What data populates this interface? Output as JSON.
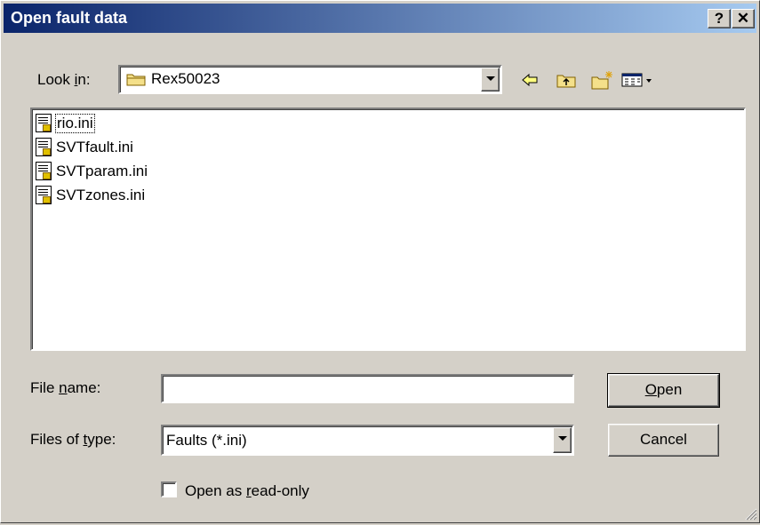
{
  "window": {
    "title": "Open fault data",
    "help_label": "?",
    "close_label": "✕"
  },
  "lookin": {
    "label_prefix": "Look ",
    "label_accel": "i",
    "label_suffix": "n:",
    "folder": "Rex50023"
  },
  "toolbar": {
    "back_icon": "back-arrow-icon",
    "up_icon": "up-folder-icon",
    "newfolder_icon": "new-folder-icon",
    "views_icon": "view-menu-icon"
  },
  "files": [
    {
      "name": "rio.ini"
    },
    {
      "name": "SVTfault.ini"
    },
    {
      "name": "SVTparam.ini"
    },
    {
      "name": "SVTzones.ini"
    }
  ],
  "filename": {
    "label_prefix": "File ",
    "label_accel": "n",
    "label_suffix": "ame:",
    "value": ""
  },
  "filetype": {
    "label_prefix": "Files of ",
    "label_accel": "t",
    "label_suffix": "ype:",
    "value": "Faults (*.ini)"
  },
  "readonly": {
    "label_prefix": "Open as ",
    "label_accel": "r",
    "label_suffix": "ead-only",
    "checked": false
  },
  "buttons": {
    "open_accel": "O",
    "open_rest": "pen",
    "cancel": "Cancel"
  },
  "colors": {
    "titlebar_start": "#0a246a",
    "titlebar_end": "#a6caf0",
    "face": "#d4d0c8"
  }
}
